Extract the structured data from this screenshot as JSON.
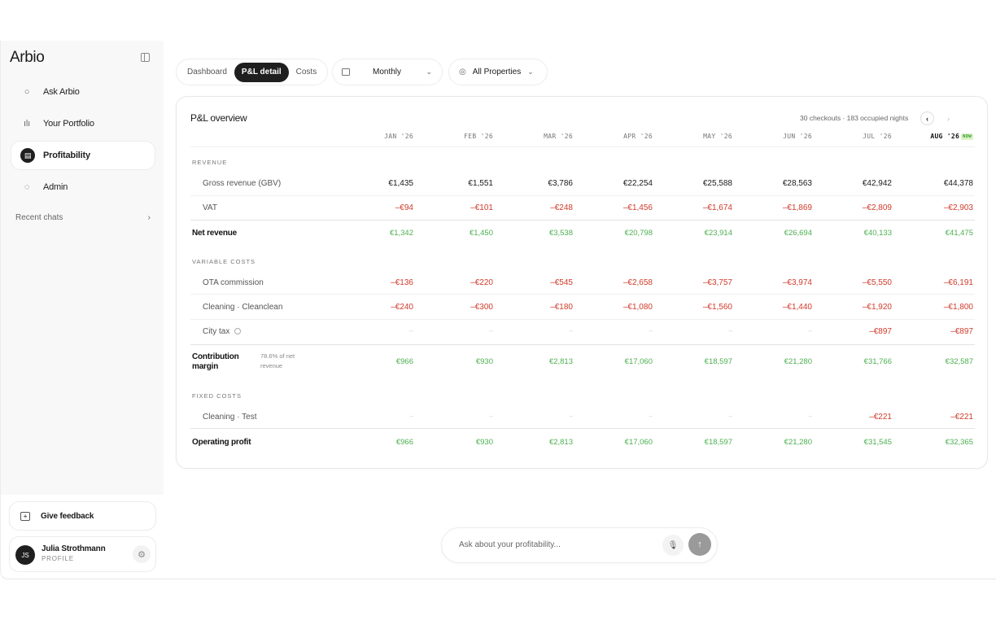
{
  "app": {
    "name": "Arbio"
  },
  "sidebar": {
    "items": [
      {
        "label": "Ask Arbio",
        "icon": "chat-icon"
      },
      {
        "label": "Your Portfolio",
        "icon": "bar-chart-icon"
      },
      {
        "label": "Profitability",
        "icon": "wallet-icon",
        "active": true
      },
      {
        "label": "Admin",
        "icon": "shield-icon"
      }
    ],
    "recent_chats": "Recent chats",
    "feedback": "Give feedback",
    "user": {
      "initials": "JS",
      "name": "Julia Strothmann",
      "role": "PROFILE"
    }
  },
  "toolbar": {
    "tabs": [
      "Dashboard",
      "P&L detail",
      "Costs"
    ],
    "active_tab": "P&L detail",
    "period": "Monthly",
    "properties": "All Properties"
  },
  "card": {
    "title": "P&L overview",
    "meta": "30 checkouts · 183 occupied nights",
    "columns": [
      "JAN '26",
      "FEB '26",
      "MAR '26",
      "APR '26",
      "MAY '26",
      "JUN '26",
      "JUL '26",
      "AUG '26"
    ],
    "now_badge": "NOW",
    "sections": {
      "revenue": "REVENUE",
      "variable_costs": "VARIABLE COSTS",
      "fixed_costs": "FIXED COSTS"
    },
    "rows": {
      "gross": {
        "label": "Gross revenue (GBV)",
        "values": [
          "€1,435",
          "€1,551",
          "€3,786",
          "€22,254",
          "€25,588",
          "€28,563",
          "€42,942",
          "€44,378"
        ]
      },
      "vat": {
        "label": "VAT",
        "values": [
          "–€94",
          "–€101",
          "–€248",
          "–€1,456",
          "–€1,674",
          "–€1,869",
          "–€2,809",
          "–€2,903"
        ]
      },
      "net": {
        "label": "Net revenue",
        "values": [
          "€1,342",
          "€1,450",
          "€3,538",
          "€20,798",
          "€23,914",
          "€26,694",
          "€40,133",
          "€41,475"
        ]
      },
      "ota": {
        "label": "OTA commission",
        "values": [
          "–€136",
          "–€220",
          "–€545",
          "–€2,658",
          "–€3,757",
          "–€3,974",
          "–€5,550",
          "–€6,191"
        ]
      },
      "cleaning_cc": {
        "label": "Cleaning · Cleanclean",
        "values": [
          "–€240",
          "–€300",
          "–€180",
          "–€1,080",
          "–€1,560",
          "–€1,440",
          "–€1,920",
          "–€1,800"
        ]
      },
      "city_tax": {
        "label": "City tax",
        "values": [
          "–",
          "–",
          "–",
          "–",
          "–",
          "–",
          "–€897",
          "–€897"
        ]
      },
      "contribution": {
        "label_line1": "Contribution",
        "label_line2": "margin",
        "note_line1": "78.6% of net",
        "note_line2": "revenue",
        "values": [
          "€966",
          "€930",
          "€2,813",
          "€17,060",
          "€18,597",
          "€21,280",
          "€31,766",
          "€32,587"
        ]
      },
      "cleaning_test": {
        "label": "Cleaning · Test",
        "values": [
          "–",
          "–",
          "–",
          "–",
          "–",
          "–",
          "–€221",
          "–€221"
        ]
      },
      "operating": {
        "label": "Operating profit",
        "values": [
          "€966",
          "€930",
          "€2,813",
          "€17,060",
          "€18,597",
          "€21,280",
          "€31,545",
          "€32,365"
        ]
      }
    }
  },
  "chat": {
    "placeholder": "Ask about your profitability..."
  },
  "colors": {
    "negative": "#d03a2a",
    "positive_total": "#4caf50",
    "active_dark": "#1f1f1f"
  }
}
